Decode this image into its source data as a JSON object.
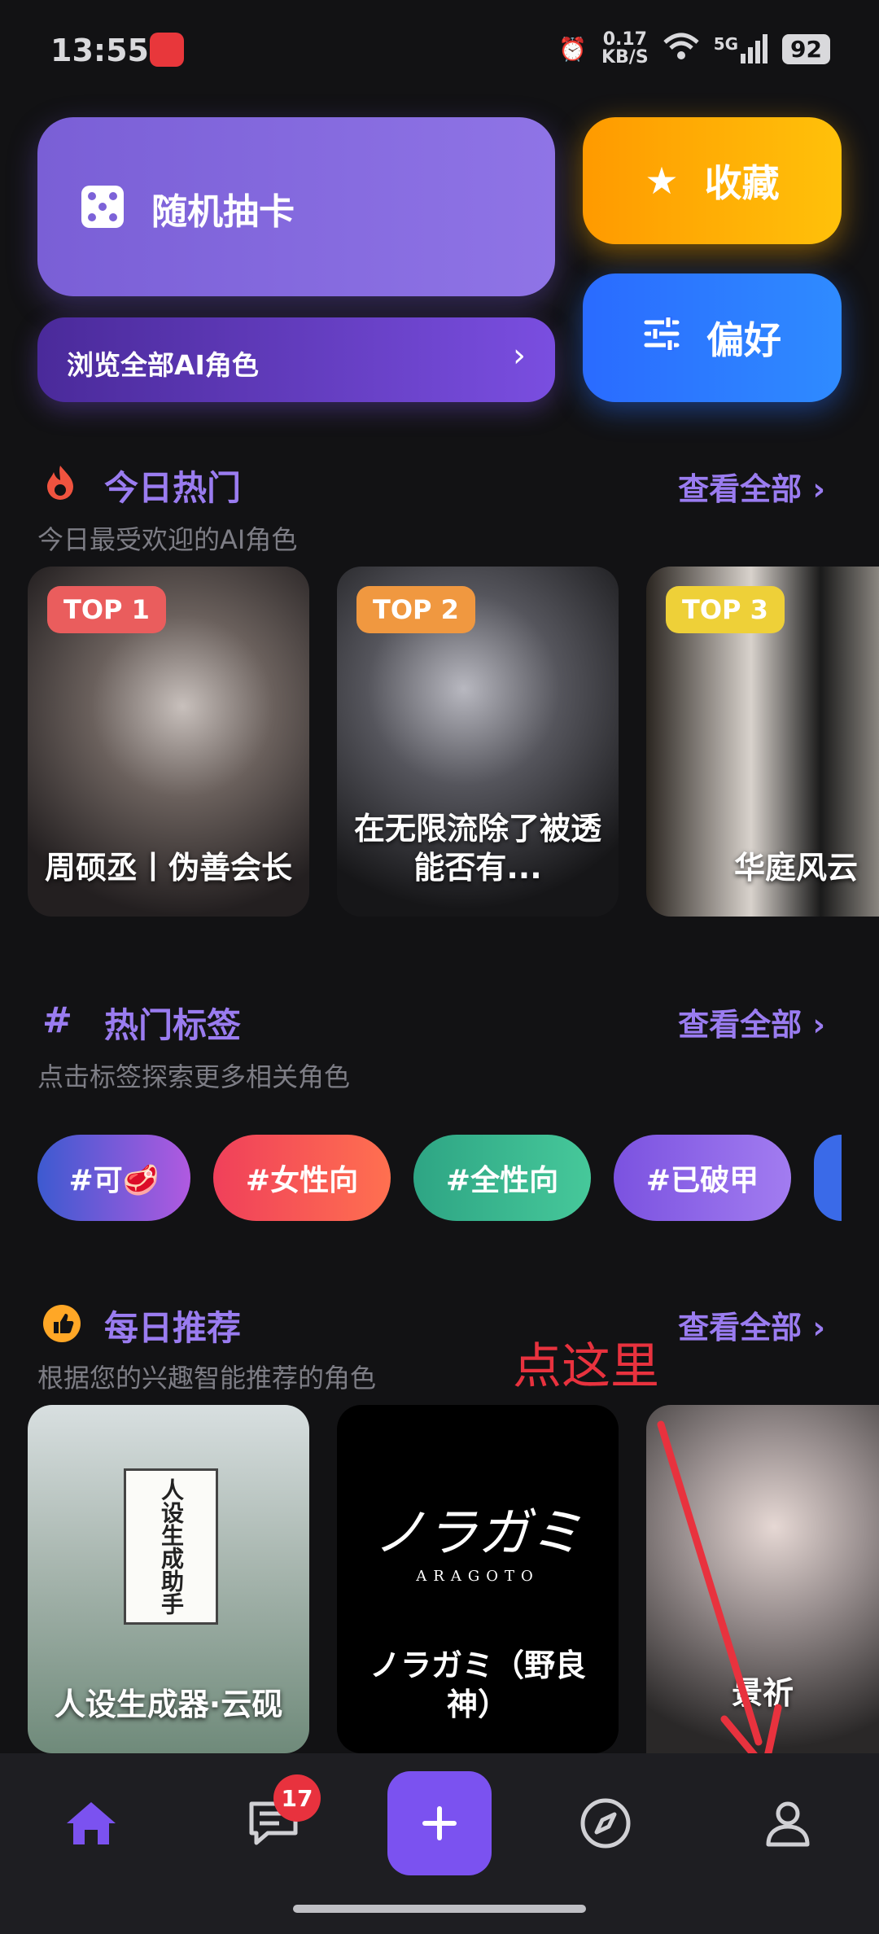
{
  "status_bar": {
    "time": "13:55",
    "speed": "0.17",
    "speed_unit": "KB/S",
    "network": "5G",
    "battery": "92"
  },
  "top": {
    "random_draw_label": "随机抽卡",
    "browse_all_label": "浏览全部AI角色",
    "favorites_label": "收藏",
    "preferences_label": "偏好"
  },
  "hot_today": {
    "title": "今日热门",
    "subtitle": "今日最受欢迎的AI角色",
    "see_all": "查看全部",
    "cards": [
      {
        "rank": "TOP 1",
        "name": "周硕丞丨伪善会长"
      },
      {
        "rank": "TOP 2",
        "name": "在无限流除了被透能否有..."
      },
      {
        "rank": "TOP 3",
        "name": "华庭风云"
      }
    ]
  },
  "hot_tags": {
    "title": "热门标签",
    "subtitle": "点击标签探索更多相关角色",
    "see_all": "查看全部",
    "tags": [
      "#可🥩",
      "#女性向",
      "#全性向",
      "#已破甲"
    ]
  },
  "daily_recommend": {
    "title": "每日推荐",
    "subtitle": "根据您的兴趣智能推荐的角色",
    "see_all": "查看全部",
    "cards": [
      {
        "name": "人设生成器·云砚",
        "cover_text": "人设生成助手"
      },
      {
        "name": "ノラガミ（野良神）",
        "cover_text": "ノラガミ",
        "cover_sub": "ARAGOTO"
      },
      {
        "name": "景祈"
      }
    ]
  },
  "annotation": "点这里",
  "nav": {
    "messages_badge": "17"
  },
  "colors": {
    "accent": "#9a7cf0",
    "favorite": "#ffb000",
    "preference": "#2a74ff",
    "background": "#121214"
  }
}
